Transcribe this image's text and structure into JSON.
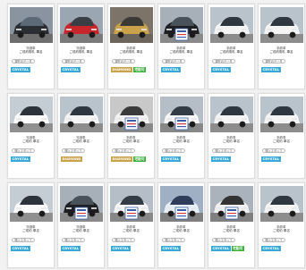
{
  "colors": {
    "crystal": "#36a9d6",
    "diamond": "#c9a24a",
    "green": "#3caf3c"
  },
  "cards": [
    {
      "category": "特選車",
      "name": "ご成約御礼 車名",
      "pill": "現在のデータ",
      "badges": [
        {
          "label": "CRYSTAL",
          "type": "crystal"
        }
      ],
      "photo": "car-dark-front"
    },
    {
      "category": "特選車",
      "name": "ご成約御礼 車名",
      "pill": "現在のデータ",
      "badges": [
        {
          "label": "CRYSTAL",
          "type": "crystal"
        }
      ],
      "photo": "car-red-front"
    },
    {
      "category": "新着車",
      "name": "ご成約御礼 車名",
      "pill": "現在のデータ",
      "badges": [
        {
          "label": "DIAMOND",
          "type": "diamond"
        },
        {
          "label": "宅配可",
          "type": "green"
        }
      ],
      "photo": "car-gold-front"
    },
    {
      "category": "新着車",
      "name": "ご成約御礼 車名",
      "pill": "現在のデータ",
      "badges": [
        {
          "label": "CRYSTAL",
          "type": "crystal"
        }
      ],
      "photo": "car-black-front"
    },
    {
      "category": "新着車",
      "name": "ご成約御礼 車名",
      "pill": "現在のデータ",
      "badges": [
        {
          "label": "CRYSTAL",
          "type": "crystal"
        }
      ],
      "photo": "car-white-front"
    },
    {
      "category": "新着車",
      "name": "ご成約御礼 車名",
      "pill": "現在のデータ",
      "badges": [
        {
          "label": "CRYSTAL",
          "type": "crystal"
        }
      ],
      "photo": "car-white-front"
    },
    {
      "category": "特選車",
      "name": "ご成約 車名",
      "pill": "購入スタッフ",
      "badges": [
        {
          "label": "CRYSTAL",
          "type": "crystal"
        }
      ],
      "photo": "car-white-side"
    },
    {
      "category": "特選車",
      "name": "ご成約 車名",
      "pill": "購入スタッフ",
      "badges": [
        {
          "label": "DIAMOND",
          "type": "diamond"
        }
      ],
      "photo": "car-white-front"
    },
    {
      "category": "新着車",
      "name": "ご成約 車名",
      "pill": "購入スタッフ",
      "badges": [
        {
          "label": "DIAMOND",
          "type": "diamond"
        },
        {
          "label": "宅配可",
          "type": "green"
        }
      ],
      "photo": "car-white-rear"
    },
    {
      "category": "新着車",
      "name": "ご成約 車名",
      "pill": "購入スタッフ",
      "badges": [
        {
          "label": "CRYSTAL",
          "type": "crystal"
        }
      ],
      "photo": "car-white-sign"
    },
    {
      "category": "新着車",
      "name": "ご成約 車名",
      "pill": "購入スタッフ",
      "badges": [
        {
          "label": "CRYSTAL",
          "type": "crystal"
        }
      ],
      "photo": "car-white-front"
    },
    {
      "category": "新着車",
      "name": "ご成約 車名",
      "pill": "購入スタッフ",
      "badges": [
        {
          "label": "CRYSTAL",
          "type": "crystal"
        }
      ],
      "photo": "car-white-front"
    },
    {
      "category": "特選車",
      "name": "ご成約 車名",
      "pill": "購入スタッフ",
      "badges": [
        {
          "label": "CRYSTAL",
          "type": "crystal"
        }
      ],
      "photo": "car-white-side"
    },
    {
      "category": "特選車",
      "name": "ご成約 車名",
      "pill": "購入スタッフ",
      "badges": [
        {
          "label": "CRYSTAL",
          "type": "crystal"
        }
      ],
      "photo": "car-black-front"
    },
    {
      "category": "新着車",
      "name": "ご成約 車名",
      "pill": "購入スタッフ",
      "badges": [
        {
          "label": "CRYSTAL",
          "type": "crystal"
        }
      ],
      "photo": "car-white-sign"
    },
    {
      "category": "新着車",
      "name": "ご成約 車名",
      "pill": "購入スタッフ",
      "badges": [
        {
          "label": "CRYSTAL",
          "type": "crystal"
        }
      ],
      "photo": "car-blue-sign"
    },
    {
      "category": "新着車",
      "name": "ご成約 車名",
      "pill": "購入スタッフ",
      "badges": [
        {
          "label": "CRYSTAL",
          "type": "crystal"
        },
        {
          "label": "宅配可",
          "type": "green"
        }
      ],
      "photo": "car-red-sign"
    },
    {
      "category": "新着車",
      "name": "ご成約 車名",
      "pill": "購入スタッフ",
      "badges": [
        {
          "label": "CRYSTAL",
          "type": "crystal"
        }
      ],
      "photo": "car-white-front"
    }
  ]
}
